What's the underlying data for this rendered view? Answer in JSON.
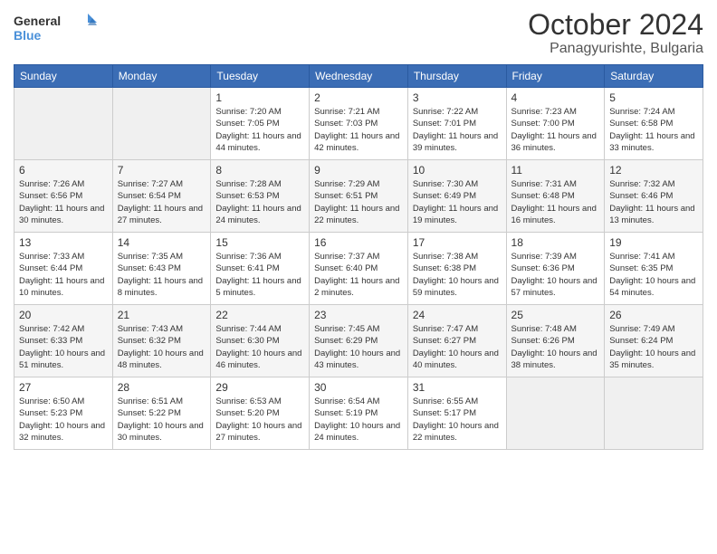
{
  "header": {
    "logo": {
      "general": "General",
      "blue": "Blue"
    },
    "title": "October 2024",
    "location": "Panagyurishte, Bulgaria"
  },
  "calendar": {
    "headers": [
      "Sunday",
      "Monday",
      "Tuesday",
      "Wednesday",
      "Thursday",
      "Friday",
      "Saturday"
    ],
    "weeks": [
      [
        {
          "day": "",
          "sunrise": "",
          "sunset": "",
          "daylight": ""
        },
        {
          "day": "",
          "sunrise": "",
          "sunset": "",
          "daylight": ""
        },
        {
          "day": "1",
          "sunrise": "Sunrise: 7:20 AM",
          "sunset": "Sunset: 7:05 PM",
          "daylight": "Daylight: 11 hours and 44 minutes."
        },
        {
          "day": "2",
          "sunrise": "Sunrise: 7:21 AM",
          "sunset": "Sunset: 7:03 PM",
          "daylight": "Daylight: 11 hours and 42 minutes."
        },
        {
          "day": "3",
          "sunrise": "Sunrise: 7:22 AM",
          "sunset": "Sunset: 7:01 PM",
          "daylight": "Daylight: 11 hours and 39 minutes."
        },
        {
          "day": "4",
          "sunrise": "Sunrise: 7:23 AM",
          "sunset": "Sunset: 7:00 PM",
          "daylight": "Daylight: 11 hours and 36 minutes."
        },
        {
          "day": "5",
          "sunrise": "Sunrise: 7:24 AM",
          "sunset": "Sunset: 6:58 PM",
          "daylight": "Daylight: 11 hours and 33 minutes."
        }
      ],
      [
        {
          "day": "6",
          "sunrise": "Sunrise: 7:26 AM",
          "sunset": "Sunset: 6:56 PM",
          "daylight": "Daylight: 11 hours and 30 minutes."
        },
        {
          "day": "7",
          "sunrise": "Sunrise: 7:27 AM",
          "sunset": "Sunset: 6:54 PM",
          "daylight": "Daylight: 11 hours and 27 minutes."
        },
        {
          "day": "8",
          "sunrise": "Sunrise: 7:28 AM",
          "sunset": "Sunset: 6:53 PM",
          "daylight": "Daylight: 11 hours and 24 minutes."
        },
        {
          "day": "9",
          "sunrise": "Sunrise: 7:29 AM",
          "sunset": "Sunset: 6:51 PM",
          "daylight": "Daylight: 11 hours and 22 minutes."
        },
        {
          "day": "10",
          "sunrise": "Sunrise: 7:30 AM",
          "sunset": "Sunset: 6:49 PM",
          "daylight": "Daylight: 11 hours and 19 minutes."
        },
        {
          "day": "11",
          "sunrise": "Sunrise: 7:31 AM",
          "sunset": "Sunset: 6:48 PM",
          "daylight": "Daylight: 11 hours and 16 minutes."
        },
        {
          "day": "12",
          "sunrise": "Sunrise: 7:32 AM",
          "sunset": "Sunset: 6:46 PM",
          "daylight": "Daylight: 11 hours and 13 minutes."
        }
      ],
      [
        {
          "day": "13",
          "sunrise": "Sunrise: 7:33 AM",
          "sunset": "Sunset: 6:44 PM",
          "daylight": "Daylight: 11 hours and 10 minutes."
        },
        {
          "day": "14",
          "sunrise": "Sunrise: 7:35 AM",
          "sunset": "Sunset: 6:43 PM",
          "daylight": "Daylight: 11 hours and 8 minutes."
        },
        {
          "day": "15",
          "sunrise": "Sunrise: 7:36 AM",
          "sunset": "Sunset: 6:41 PM",
          "daylight": "Daylight: 11 hours and 5 minutes."
        },
        {
          "day": "16",
          "sunrise": "Sunrise: 7:37 AM",
          "sunset": "Sunset: 6:40 PM",
          "daylight": "Daylight: 11 hours and 2 minutes."
        },
        {
          "day": "17",
          "sunrise": "Sunrise: 7:38 AM",
          "sunset": "Sunset: 6:38 PM",
          "daylight": "Daylight: 10 hours and 59 minutes."
        },
        {
          "day": "18",
          "sunrise": "Sunrise: 7:39 AM",
          "sunset": "Sunset: 6:36 PM",
          "daylight": "Daylight: 10 hours and 57 minutes."
        },
        {
          "day": "19",
          "sunrise": "Sunrise: 7:41 AM",
          "sunset": "Sunset: 6:35 PM",
          "daylight": "Daylight: 10 hours and 54 minutes."
        }
      ],
      [
        {
          "day": "20",
          "sunrise": "Sunrise: 7:42 AM",
          "sunset": "Sunset: 6:33 PM",
          "daylight": "Daylight: 10 hours and 51 minutes."
        },
        {
          "day": "21",
          "sunrise": "Sunrise: 7:43 AM",
          "sunset": "Sunset: 6:32 PM",
          "daylight": "Daylight: 10 hours and 48 minutes."
        },
        {
          "day": "22",
          "sunrise": "Sunrise: 7:44 AM",
          "sunset": "Sunset: 6:30 PM",
          "daylight": "Daylight: 10 hours and 46 minutes."
        },
        {
          "day": "23",
          "sunrise": "Sunrise: 7:45 AM",
          "sunset": "Sunset: 6:29 PM",
          "daylight": "Daylight: 10 hours and 43 minutes."
        },
        {
          "day": "24",
          "sunrise": "Sunrise: 7:47 AM",
          "sunset": "Sunset: 6:27 PM",
          "daylight": "Daylight: 10 hours and 40 minutes."
        },
        {
          "day": "25",
          "sunrise": "Sunrise: 7:48 AM",
          "sunset": "Sunset: 6:26 PM",
          "daylight": "Daylight: 10 hours and 38 minutes."
        },
        {
          "day": "26",
          "sunrise": "Sunrise: 7:49 AM",
          "sunset": "Sunset: 6:24 PM",
          "daylight": "Daylight: 10 hours and 35 minutes."
        }
      ],
      [
        {
          "day": "27",
          "sunrise": "Sunrise: 6:50 AM",
          "sunset": "Sunset: 5:23 PM",
          "daylight": "Daylight: 10 hours and 32 minutes."
        },
        {
          "day": "28",
          "sunrise": "Sunrise: 6:51 AM",
          "sunset": "Sunset: 5:22 PM",
          "daylight": "Daylight: 10 hours and 30 minutes."
        },
        {
          "day": "29",
          "sunrise": "Sunrise: 6:53 AM",
          "sunset": "Sunset: 5:20 PM",
          "daylight": "Daylight: 10 hours and 27 minutes."
        },
        {
          "day": "30",
          "sunrise": "Sunrise: 6:54 AM",
          "sunset": "Sunset: 5:19 PM",
          "daylight": "Daylight: 10 hours and 24 minutes."
        },
        {
          "day": "31",
          "sunrise": "Sunrise: 6:55 AM",
          "sunset": "Sunset: 5:17 PM",
          "daylight": "Daylight: 10 hours and 22 minutes."
        },
        {
          "day": "",
          "sunrise": "",
          "sunset": "",
          "daylight": ""
        },
        {
          "day": "",
          "sunrise": "",
          "sunset": "",
          "daylight": ""
        }
      ]
    ]
  }
}
